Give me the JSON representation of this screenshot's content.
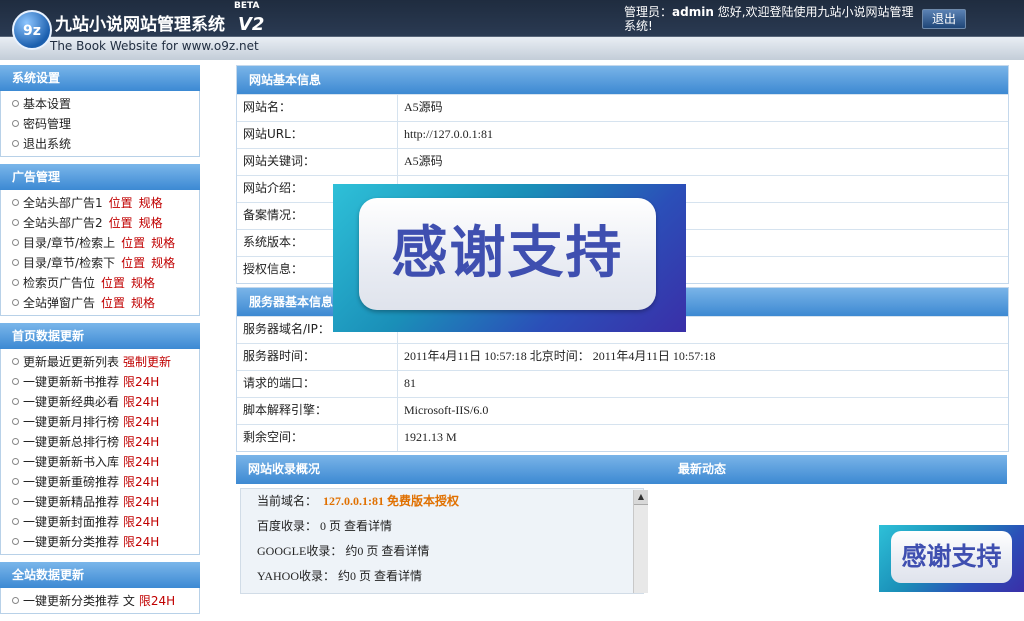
{
  "header": {
    "logo_text": "9z",
    "title": "九站小说网站管理系统",
    "beta": "BETA",
    "version": "V2",
    "subtitle": "The Book Website for www.o9z.net",
    "admin_label": "管理员：",
    "admin_name": "admin",
    "welcome": " 您好,欢迎登陆使用九站小说网站管理系统!",
    "logout": "退出"
  },
  "sidebar": {
    "system": {
      "title": "系统设置",
      "items": [
        "基本设置",
        "密码管理",
        "退出系统"
      ]
    },
    "ads": {
      "title": "广告管理",
      "items": [
        {
          "label": "全站头部广告1",
          "pos": "位置",
          "spec": "规格"
        },
        {
          "label": "全站头部广告2",
          "pos": "位置",
          "spec": "规格"
        },
        {
          "label": "目录/章节/检索上",
          "pos": "位置",
          "spec": "规格"
        },
        {
          "label": "目录/章节/检索下",
          "pos": "位置",
          "spec": "规格"
        },
        {
          "label": "检索页广告位",
          "pos": "位置",
          "spec": "规格"
        },
        {
          "label": "全站弹窗广告",
          "pos": "位置",
          "spec": "规格"
        }
      ]
    },
    "home": {
      "title": "首页数据更新",
      "items": [
        {
          "label": "更新最近更新列表",
          "tag": "强制更新"
        },
        {
          "label": "一键更新新书推荐",
          "tag": "限24H"
        },
        {
          "label": "一键更新经典必看",
          "tag": "限24H"
        },
        {
          "label": "一键更新月排行榜",
          "tag": "限24H"
        },
        {
          "label": "一键更新总排行榜",
          "tag": "限24H"
        },
        {
          "label": "一键更新新书入库",
          "tag": "限24H"
        },
        {
          "label": "一键更新重磅推荐",
          "tag": "限24H"
        },
        {
          "label": "一键更新精品推荐",
          "tag": "限24H"
        },
        {
          "label": "一键更新封面推荐",
          "tag": "限24H"
        },
        {
          "label": "一键更新分类推荐",
          "tag": "限24H"
        }
      ]
    },
    "site": {
      "title": "全站数据更新",
      "items": [
        {
          "label": "一键更新分类推荐 文",
          "tag": "限24H"
        }
      ]
    }
  },
  "site_info": {
    "title": "网站基本信息",
    "rows": [
      {
        "k": "网站名：",
        "v": "A5源码"
      },
      {
        "k": "网站URL：",
        "v": "http://127.0.0.1:81"
      },
      {
        "k": "网站关键词：",
        "v": "A5源码"
      },
      {
        "k": "网站介绍：",
        "v": ""
      },
      {
        "k": "备案情况：",
        "v": ""
      },
      {
        "k": "系统版本：",
        "v": ""
      },
      {
        "k": "授权信息：",
        "v": ""
      }
    ]
  },
  "server_info": {
    "title": "服务器基本信息",
    "rows": [
      {
        "k": "服务器域名/IP：",
        "v": ""
      },
      {
        "k": "服务器时间：",
        "v": "2011年4月11日 10:57:18 北京时间： 2011年4月11日 10:57:18"
      },
      {
        "k": "请求的端口：",
        "v": "81"
      },
      {
        "k": "脚本解释引擎：",
        "v": "Microsoft-IIS/6.0"
      },
      {
        "k": "剩余空间：",
        "v": "1921.13 M"
      }
    ]
  },
  "stats": {
    "title": "网站收录概况",
    "recent_title": "最新动态",
    "domain_label": "当前域名：",
    "domain_value": "127.0.0.1:81 免费版本授权",
    "lines": [
      {
        "label": "百度收录：",
        "value": "0 页",
        "link": "查看详情"
      },
      {
        "label": "GOOGLE收录：",
        "value": "约0 页",
        "link": "查看详情"
      },
      {
        "label": "YAHOO收录：",
        "value": "约0 页",
        "link": "查看详情"
      }
    ]
  },
  "watermark": {
    "text": "感谢支持",
    "text_small": "感谢支持"
  }
}
